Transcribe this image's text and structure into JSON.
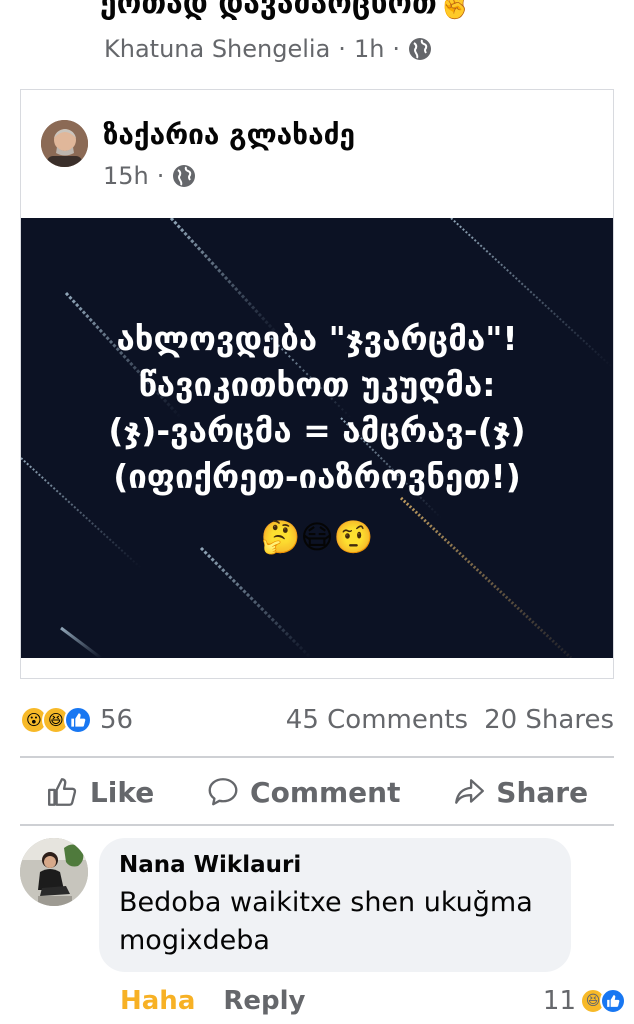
{
  "prev_post": {
    "title": "ერთად დავამარცხოთ✌️",
    "author": "Khatuna Shengelia",
    "time": "1h",
    "separator": "·"
  },
  "shared_post": {
    "author": "ზაქარია გლახაძე",
    "time": "15h",
    "separator": "·",
    "image_lines": [
      "ახლოვდება \"ჯვარცმა\"!",
      "წავიკითხოთ უკუღმა:",
      "(ჯ)-ვარცმა = ამცრავ-(ჯ)",
      "(იფიქრეთ-იაზროვნეთ!)"
    ],
    "image_emojis": "🤔😷🤨",
    "image_bg": "#0c1224"
  },
  "reactions": {
    "count": "56",
    "icons": [
      "wow-icon",
      "haha-icon",
      "like-icon"
    ],
    "comments": "45 Comments",
    "shares": "20 Shares"
  },
  "actions": {
    "like": "Like",
    "comment": "Comment",
    "share": "Share"
  },
  "comment": {
    "author": "Nana Wiklauri",
    "text": "Bedoba waikitxe shen ukuğma mogixdeba",
    "reaction_label": "Haha",
    "reply_label": "Reply",
    "reaction_count": "11"
  },
  "colors": {
    "meta_gray": "#65676b",
    "like_blue": "#1877f2",
    "haha_yellow": "#f7b125",
    "bubble_bg": "#f0f2f5"
  }
}
